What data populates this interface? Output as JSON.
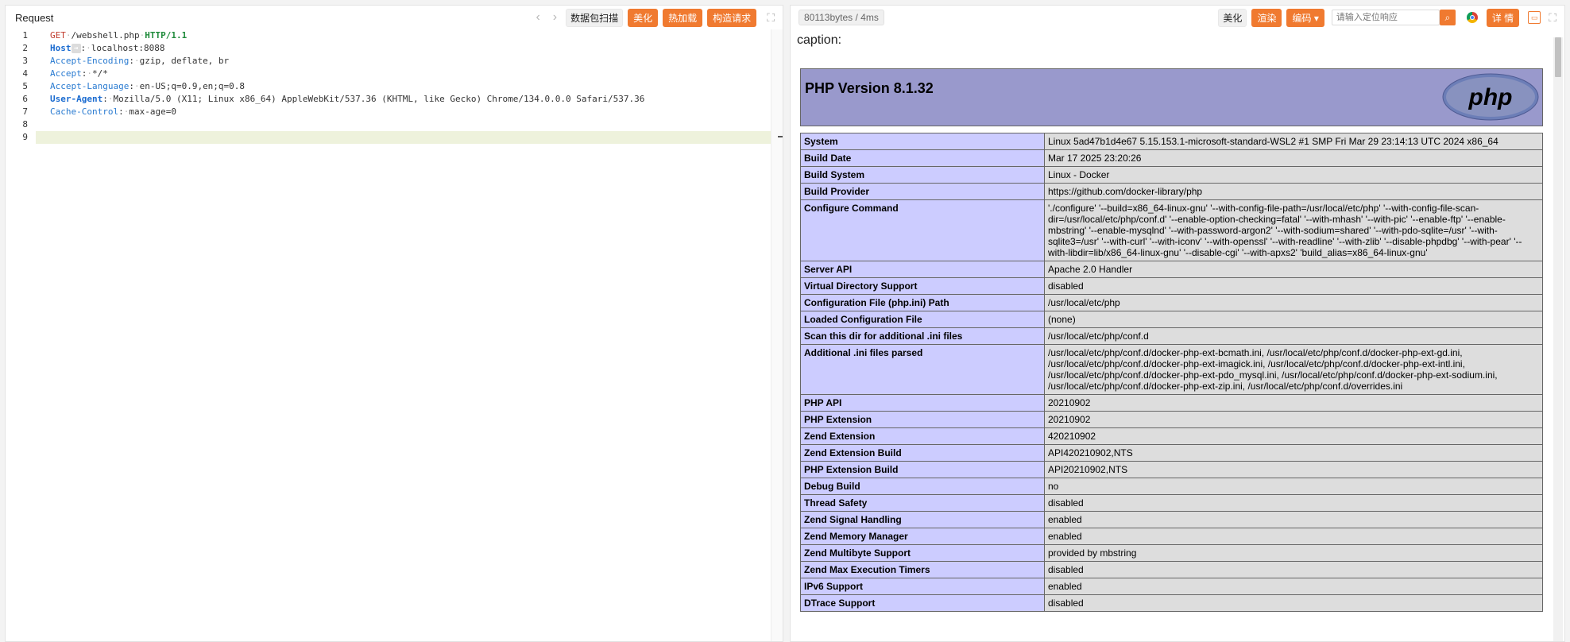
{
  "left": {
    "title": "Request",
    "buttons": {
      "scan": "数据包扫描",
      "beautify": "美化",
      "hot_load": "热加载",
      "build": "构造请求"
    },
    "lines": [
      {
        "n": "1"
      },
      {
        "n": "2"
      },
      {
        "n": "3"
      },
      {
        "n": "4"
      },
      {
        "n": "5"
      },
      {
        "n": "6"
      },
      {
        "n": "7"
      },
      {
        "n": "8"
      },
      {
        "n": "9"
      }
    ],
    "request": {
      "method": "GET",
      "path": "/webshell.php",
      "protocol": "HTTP/1.1",
      "headers": [
        {
          "name": "Host",
          "value": "localhost:8088"
        },
        {
          "name": "Accept-Encoding",
          "value": "gzip, deflate, br"
        },
        {
          "name": "Accept",
          "value": "*/*"
        },
        {
          "name": "Accept-Language",
          "value": "en-US;q=0.9,en;q=0.8"
        },
        {
          "name": "User-Agent",
          "value": "Mozilla/5.0 (X11; Linux x86_64) AppleWebKit/537.36 (KHTML, like Gecko) Chrome/134.0.0.0 Safari/537.36"
        },
        {
          "name": "Cache-Control",
          "value": "max-age=0"
        }
      ]
    }
  },
  "right": {
    "size_badge": "80113bytes / 4ms",
    "buttons": {
      "beautify": "美化",
      "render": "渲染",
      "encoding": "编码",
      "details": "详 情"
    },
    "search_placeholder": "请输入定位响应",
    "caption": "caption:",
    "php_version": "PHP Version 8.1.32",
    "logo_text": "php",
    "rows": [
      {
        "k": "System",
        "v": "Linux 5ad47b1d4e67 5.15.153.1-microsoft-standard-WSL2 #1 SMP Fri Mar 29 23:14:13 UTC 2024 x86_64"
      },
      {
        "k": "Build Date",
        "v": "Mar 17 2025 23:20:26"
      },
      {
        "k": "Build System",
        "v": "Linux - Docker"
      },
      {
        "k": "Build Provider",
        "v": "https://github.com/docker-library/php"
      },
      {
        "k": "Configure Command",
        "v": "'./configure' '--build=x86_64-linux-gnu' '--with-config-file-path=/usr/local/etc/php' '--with-config-file-scan-dir=/usr/local/etc/php/conf.d' '--enable-option-checking=fatal' '--with-mhash' '--with-pic' '--enable-ftp' '--enable-mbstring' '--enable-mysqlnd' '--with-password-argon2' '--with-sodium=shared' '--with-pdo-sqlite=/usr' '--with-sqlite3=/usr' '--with-curl' '--with-iconv' '--with-openssl' '--with-readline' '--with-zlib' '--disable-phpdbg' '--with-pear' '--with-libdir=lib/x86_64-linux-gnu' '--disable-cgi' '--with-apxs2' 'build_alias=x86_64-linux-gnu'"
      },
      {
        "k": "Server API",
        "v": "Apache 2.0 Handler"
      },
      {
        "k": "Virtual Directory Support",
        "v": "disabled"
      },
      {
        "k": "Configuration File (php.ini) Path",
        "v": "/usr/local/etc/php"
      },
      {
        "k": "Loaded Configuration File",
        "v": "(none)"
      },
      {
        "k": "Scan this dir for additional .ini files",
        "v": "/usr/local/etc/php/conf.d"
      },
      {
        "k": "Additional .ini files parsed",
        "v": "/usr/local/etc/php/conf.d/docker-php-ext-bcmath.ini, /usr/local/etc/php/conf.d/docker-php-ext-gd.ini, /usr/local/etc/php/conf.d/docker-php-ext-imagick.ini, /usr/local/etc/php/conf.d/docker-php-ext-intl.ini, /usr/local/etc/php/conf.d/docker-php-ext-pdo_mysql.ini, /usr/local/etc/php/conf.d/docker-php-ext-sodium.ini, /usr/local/etc/php/conf.d/docker-php-ext-zip.ini, /usr/local/etc/php/conf.d/overrides.ini"
      },
      {
        "k": "PHP API",
        "v": "20210902"
      },
      {
        "k": "PHP Extension",
        "v": "20210902"
      },
      {
        "k": "Zend Extension",
        "v": "420210902"
      },
      {
        "k": "Zend Extension Build",
        "v": "API420210902,NTS"
      },
      {
        "k": "PHP Extension Build",
        "v": "API20210902,NTS"
      },
      {
        "k": "Debug Build",
        "v": "no"
      },
      {
        "k": "Thread Safety",
        "v": "disabled"
      },
      {
        "k": "Zend Signal Handling",
        "v": "enabled"
      },
      {
        "k": "Zend Memory Manager",
        "v": "enabled"
      },
      {
        "k": "Zend Multibyte Support",
        "v": "provided by mbstring"
      },
      {
        "k": "Zend Max Execution Timers",
        "v": "disabled"
      },
      {
        "k": "IPv6 Support",
        "v": "enabled"
      },
      {
        "k": "DTrace Support",
        "v": "disabled"
      }
    ]
  },
  "colors": {
    "accent": "#f07a30",
    "php_header": "#9999cc",
    "table_key": "#ccccff",
    "table_value": "#dddddd"
  }
}
